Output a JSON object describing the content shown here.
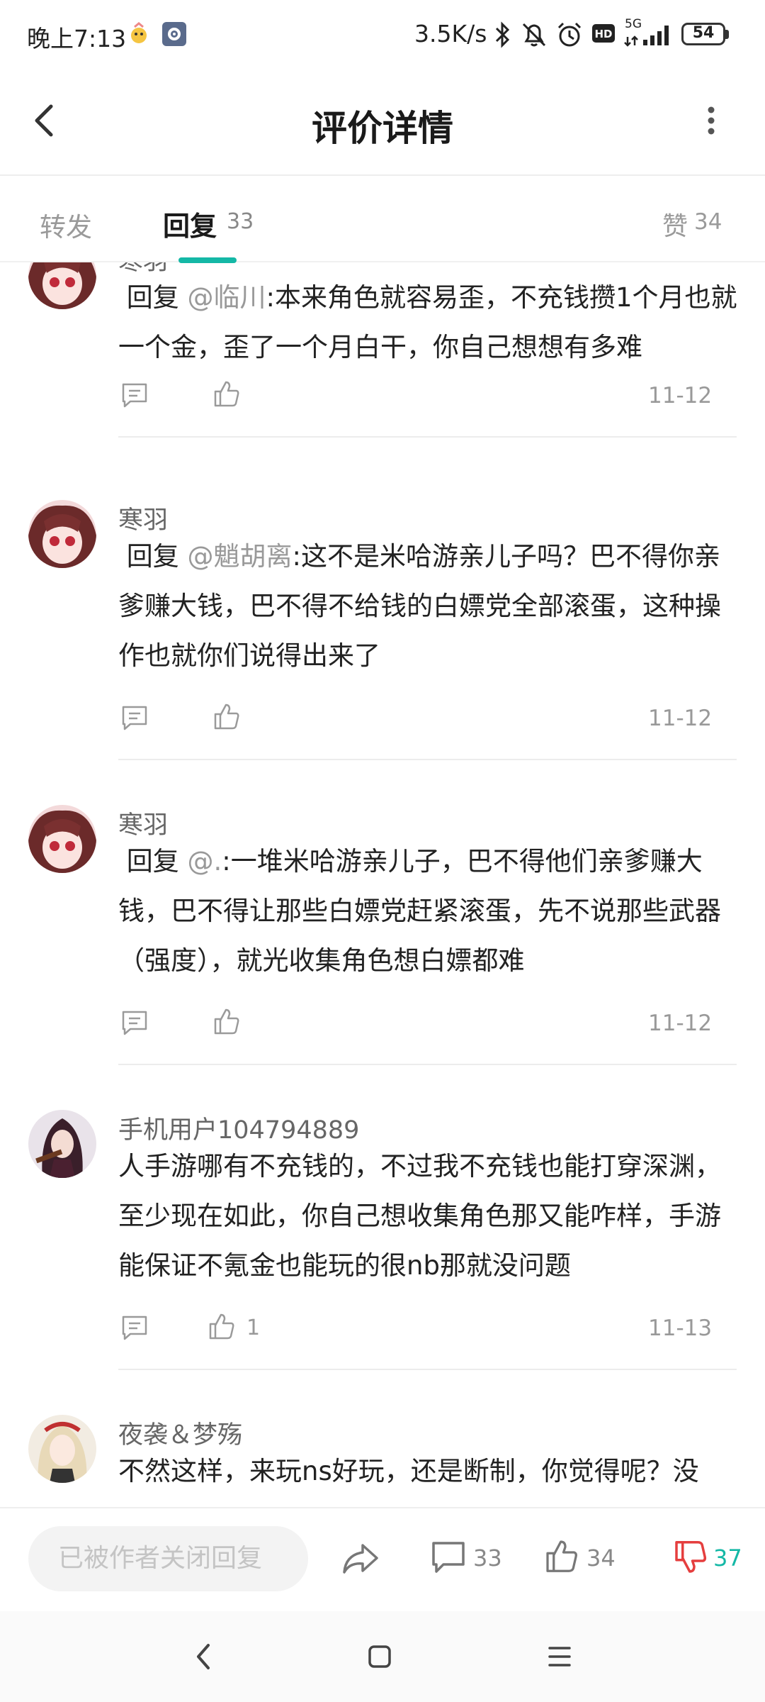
{
  "status_bar": {
    "time": "晚上7:13",
    "network_speed": "3.5K/s",
    "signal": "5G",
    "battery": "54"
  },
  "header": {
    "title": "评价详情",
    "back_icon": "back-arrow-icon",
    "more_icon": "more-vertical-icon"
  },
  "tabs": {
    "forward_label": "转发",
    "reply_label": "回复",
    "reply_count": "33",
    "likes_label": "赞",
    "likes_count": "34",
    "accent_color": "#14b8a6"
  },
  "comments": [
    {
      "username": "寒羽",
      "reply_prefix": "回复",
      "mention": "@临川",
      "text": ":本来角色就容易歪，不充钱攒1个月也就一个金，歪了一个月白干，你自己想想有多难",
      "likes": "",
      "date": "11-12"
    },
    {
      "username": "寒羽",
      "reply_prefix": "回复",
      "mention": "@魈胡离",
      "text": ":这不是米哈游亲儿子吗？巴不得你亲爹赚大钱，巴不得不给钱的白嫖党全部滚蛋，这种操作也就你们说得出来了",
      "likes": "",
      "date": "11-12"
    },
    {
      "username": "寒羽",
      "reply_prefix": "回复",
      "mention": "@.",
      "text": ":一堆米哈游亲儿子，巴不得他们亲爹赚大钱，巴不得让那些白嫖党赶紧滚蛋，先不说那些武器（强度），就光收集角色想白嫖都难",
      "likes": "",
      "date": "11-12"
    },
    {
      "username": "手机用户104794889",
      "reply_prefix": "",
      "mention": "",
      "text": "人手游哪有不充钱的，不过我不充钱也能打穿深渊，至少现在如此，你自己想收集角色那又能咋样，手游能保证不氪金也能玩的很nb那就没问题",
      "likes": "1",
      "date": "11-13"
    },
    {
      "username": "夜袭＆梦殇",
      "reply_prefix": "",
      "mention": "",
      "text": "不然这样，来玩ns好玩，还是断制，你觉得呢？没",
      "likes": "",
      "date": ""
    }
  ],
  "bottom_bar": {
    "closed_placeholder": "已被作者关闭回复",
    "comment_count": "33",
    "like_count": "34",
    "dislike_count": "37",
    "dislike_color": "#e53e3e"
  },
  "nav_bar": {
    "back": "nav-back-icon",
    "home": "nav-home-icon",
    "menu": "nav-menu-icon"
  }
}
